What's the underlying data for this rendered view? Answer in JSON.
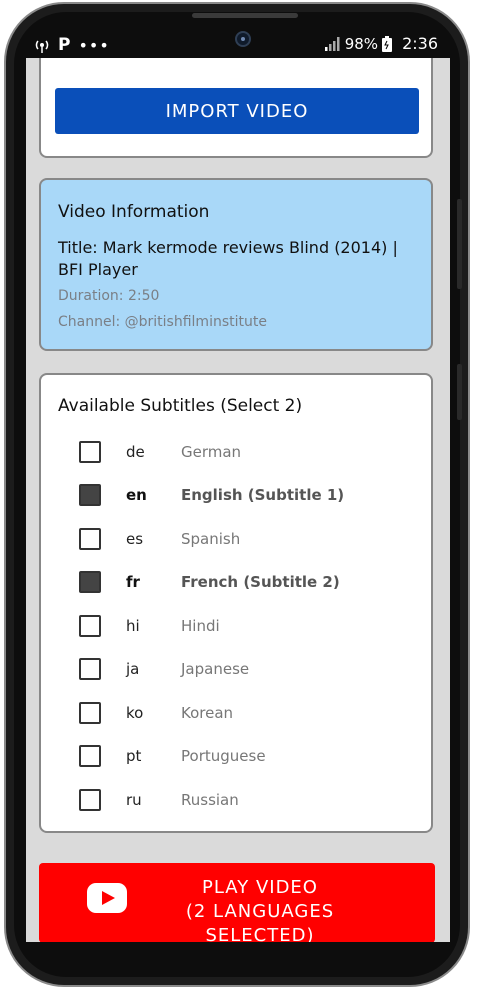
{
  "status_bar": {
    "left_icons": [
      "hotspot-icon",
      "p-icon",
      "more-icon"
    ],
    "p_label": "P",
    "dots": "•••",
    "battery": "98%",
    "time": "2:36"
  },
  "import": {
    "button_label": "IMPORT VIDEO"
  },
  "video_info": {
    "heading": "Video Information",
    "title": "Title: Mark kermode reviews Blind (2014) | BFI Player",
    "duration": "Duration: 2:50",
    "channel": "Channel: @britishfilminstitute"
  },
  "subtitles": {
    "heading": "Available Subtitles (Select 2)",
    "items": [
      {
        "code": "de",
        "name": "German",
        "checked": false
      },
      {
        "code": "en",
        "name": "English (Subtitle 1)",
        "checked": true
      },
      {
        "code": "es",
        "name": "Spanish",
        "checked": false
      },
      {
        "code": "fr",
        "name": "French (Subtitle 2)",
        "checked": true
      },
      {
        "code": "hi",
        "name": "Hindi",
        "checked": false
      },
      {
        "code": "ja",
        "name": "Japanese",
        "checked": false
      },
      {
        "code": "ko",
        "name": "Korean",
        "checked": false
      },
      {
        "code": "pt",
        "name": "Portuguese",
        "checked": false
      },
      {
        "code": "ru",
        "name": "Russian",
        "checked": false
      }
    ]
  },
  "play": {
    "line1": "PLAY VIDEO",
    "line2": "(2 LANGUAGES SELECTED)",
    "icon": "youtube-icon"
  },
  "colors": {
    "import_button": "#0a4fb9",
    "info_card": "#a9d8f8",
    "play_button": "#ff0000"
  }
}
